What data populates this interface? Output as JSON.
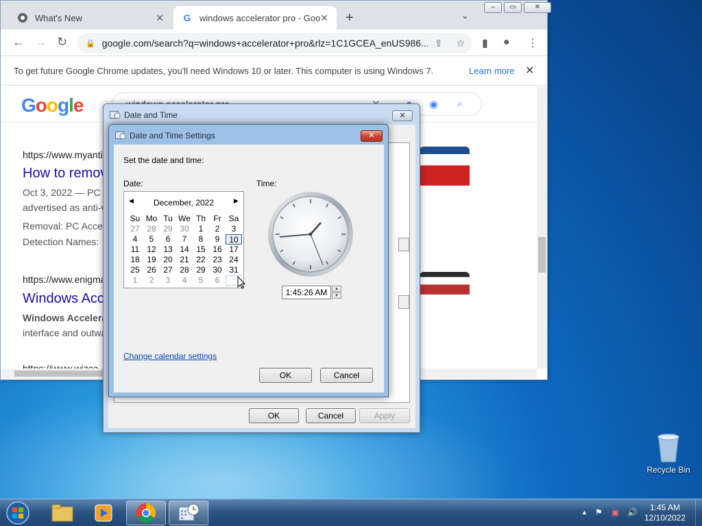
{
  "browser": {
    "tabs": [
      {
        "title": "What's New"
      },
      {
        "title": "windows accelerator pro - Google Search"
      }
    ],
    "url": "google.com/search?q=windows+accelerator+pro&rlz=1C1GCEA_enUS986...",
    "infobar": {
      "message": "To get future Google Chrome updates, you'll need Windows 10 or later. This computer is using Windows 7.",
      "learn_more": "Learn more"
    },
    "search_query": "windows accelerator pro",
    "results": [
      {
        "url": "https://www.myanti",
        "title": "How to remov",
        "snippet1": "Oct 3, 2022 — PC",
        "snippet2": "advertised as anti-v",
        "meta1": "Removal: PC Acce",
        "meta2": "Detection Names: "
      },
      {
        "url": "https://www.enigma",
        "title": "Windows Acc",
        "snippet1": "Windows Accelera",
        "snippet2": "interface and outwa"
      }
    ],
    "partial_url3": "https://www.wizca"
  },
  "outer_dialog": {
    "title": "Date and Time",
    "ok": "OK",
    "cancel": "Cancel",
    "apply": "Apply"
  },
  "inner_dialog": {
    "title": "Date and Time Settings",
    "instruction": "Set the date and time:",
    "date_label": "Date:",
    "time_label": "Time:",
    "month_label": "December, 2022",
    "weekdays": [
      "Su",
      "Mo",
      "Tu",
      "We",
      "Th",
      "Fr",
      "Sa"
    ],
    "weeks": [
      [
        "27",
        "28",
        "29",
        "30",
        "1",
        "2",
        "3"
      ],
      [
        "4",
        "5",
        "6",
        "7",
        "8",
        "9",
        "10"
      ],
      [
        "11",
        "12",
        "13",
        "14",
        "15",
        "16",
        "17"
      ],
      [
        "18",
        "19",
        "20",
        "21",
        "22",
        "23",
        "24"
      ],
      [
        "25",
        "26",
        "27",
        "28",
        "29",
        "30",
        "31"
      ],
      [
        "1",
        "2",
        "3",
        "4",
        "5",
        "6",
        ""
      ]
    ],
    "selected_day": "10",
    "time_value": "1:45:26 AM",
    "change_calendar": "Change calendar settings",
    "ok": "OK",
    "cancel": "Cancel"
  },
  "desktop": {
    "recycle_bin": "Recycle Bin"
  },
  "taskbar": {
    "time": "1:45 AM",
    "date": "12/10/2022"
  }
}
